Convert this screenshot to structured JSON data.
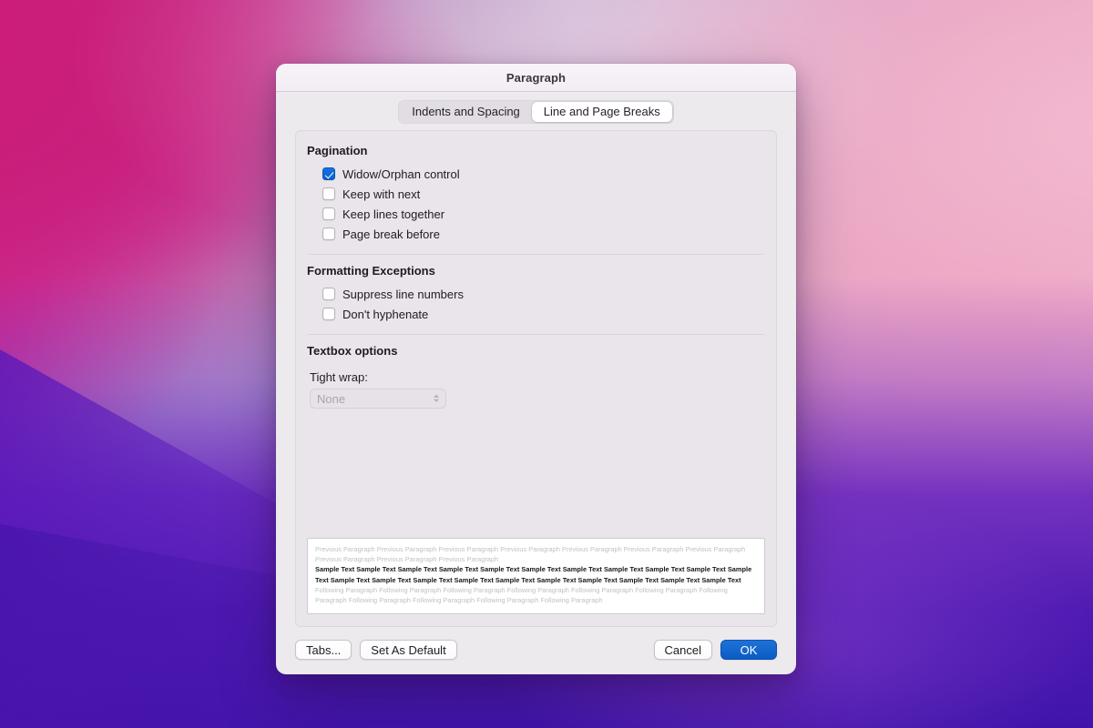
{
  "window": {
    "title": "Paragraph"
  },
  "tabs": [
    {
      "label": "Indents and Spacing",
      "active": false
    },
    {
      "label": "Line and Page Breaks",
      "active": true
    }
  ],
  "sections": {
    "pagination": {
      "title": "Pagination",
      "options": [
        {
          "label": "Widow/Orphan control",
          "checked": true
        },
        {
          "label": "Keep with next",
          "checked": false
        },
        {
          "label": "Keep lines together",
          "checked": false
        },
        {
          "label": "Page break before",
          "checked": false
        }
      ]
    },
    "formatting_exceptions": {
      "title": "Formatting Exceptions",
      "options": [
        {
          "label": "Suppress line numbers",
          "checked": false
        },
        {
          "label": "Don't hyphenate",
          "checked": false
        }
      ]
    },
    "textbox_options": {
      "title": "Textbox options",
      "tight_wrap_label": "Tight wrap:",
      "tight_wrap_value": "None"
    }
  },
  "preview": {
    "previous_paragraph": "Previous Paragraph Previous Paragraph Previous Paragraph Previous Paragraph Previous Paragraph Previous Paragraph Previous Paragraph Previous Paragraph Previous Paragraph Previous Paragraph",
    "sample_text": "Sample Text Sample Text Sample Text Sample Text Sample Text Sample Text Sample Text Sample Text Sample Text Sample Text Sample Text Sample Text Sample Text Sample Text Sample Text Sample Text Sample Text Sample Text Sample Text Sample Text Sample Text",
    "following_paragraph": "Following Paragraph Following Paragraph Following Paragraph Following Paragraph Following Paragraph Following Paragraph Following Paragraph Following Paragraph Following Paragraph Following Paragraph Following Paragraph"
  },
  "footer": {
    "tabs_button": "Tabs...",
    "set_as_default_button": "Set As Default",
    "cancel_button": "Cancel",
    "ok_button": "OK"
  },
  "colors": {
    "accent_blue": "#0a5cc4",
    "window_bg": "#edeaee",
    "panel_bg": "#e9e5ea"
  }
}
